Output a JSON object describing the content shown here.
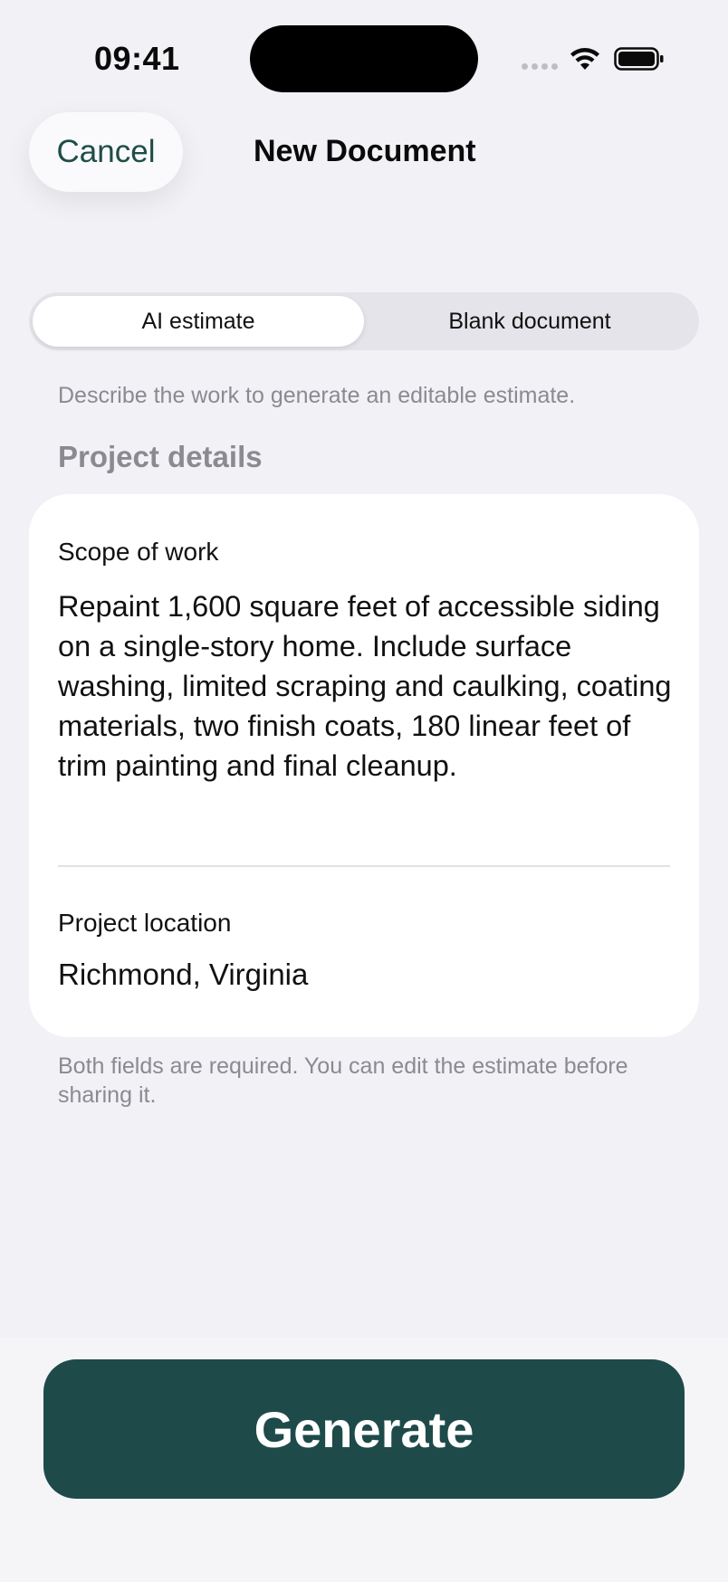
{
  "status_bar": {
    "time": "09:41"
  },
  "header": {
    "cancel_label": "Cancel",
    "title": "New Document"
  },
  "segmented": {
    "options": [
      {
        "label": "AI estimate",
        "selected": true
      },
      {
        "label": "Blank document",
        "selected": false
      }
    ]
  },
  "helper_text": "Describe the work to generate an editable estimate.",
  "section_label": "Project details",
  "form": {
    "scope_label": "Scope of work",
    "scope_value": "Repaint 1,600 square feet of accessible siding on a single-story home. Include surface washing, limited scraping and caulking, coating materials, two finish coats, 180 linear feet of trim painting and final cleanup.",
    "location_label": "Project location",
    "location_value": "Richmond, Virginia"
  },
  "footnote": "Both fields are required. You can edit the estimate before sharing it.",
  "primary_action": {
    "label": "Generate"
  },
  "colors": {
    "accent": "#1F4A4A",
    "background": "#F1F1F6",
    "secondary_text": "#8A8A90"
  },
  "icons": [
    "signal-icon",
    "wifi-icon",
    "battery-icon"
  ]
}
